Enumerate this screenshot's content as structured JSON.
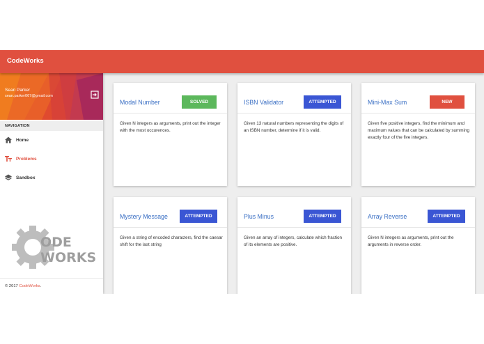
{
  "app": {
    "title": "CodeWorks",
    "accent": "#e0503f"
  },
  "user": {
    "name": "Sean Parker",
    "email": "sean.parker067@gmail.com"
  },
  "nav": {
    "header": "NAVIGATION",
    "items": [
      {
        "label": "Home",
        "icon": "home-icon",
        "active": false
      },
      {
        "label": "Problems",
        "icon": "text-format-icon",
        "active": true
      },
      {
        "label": "Sandbox",
        "icon": "layers-icon",
        "active": false
      }
    ]
  },
  "logo": {
    "text_top": "ODE",
    "text_bottom": "WORKS"
  },
  "footer": {
    "prefix": "© 2017 ",
    "brand": "CodeWorks",
    "suffix": "."
  },
  "status_colors": {
    "SOLVED": "#5cb85c",
    "ATTEMPTED": "#3a56d4",
    "NEW": "#e0503f"
  },
  "problems": [
    {
      "title": "Modal Number",
      "status": "SOLVED",
      "description": "Given N integers as arguments, print out the integer with the most occurences."
    },
    {
      "title": "ISBN Validator",
      "status": "ATTEMPTED",
      "description": "Given 13 natural numbers representing the digits of an ISBN number, determine if it is valid."
    },
    {
      "title": "Mini-Max Sum",
      "status": "NEW",
      "description": "Given five positive integers, find the minimum and maximum values that can be calculated by summing exactly four of the five integers."
    },
    {
      "title": "Mystery Message",
      "status": "ATTEMPTED",
      "description": "Given a string of encoded characters, find the caesar shift for the last string"
    },
    {
      "title": "Plus Minus",
      "status": "ATTEMPTED",
      "description": "Given an array of integers, calculate which fraction of its elements are positive."
    },
    {
      "title": "Array Reverse",
      "status": "ATTEMPTED",
      "description": "Given N integers as arguments, print out the arguments in reverse order."
    }
  ]
}
